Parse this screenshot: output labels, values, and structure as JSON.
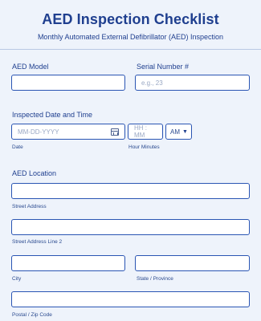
{
  "header": {
    "title": "AED Inspection Checklist",
    "subtitle": "Monthly Automated External Defibrillator (AED) Inspection"
  },
  "aed_model": {
    "label": "AED Model",
    "value": ""
  },
  "serial": {
    "label": "Serial Number #",
    "placeholder": "e.g., 23"
  },
  "inspected": {
    "label": "Inspected Date and Time",
    "date_placeholder": "MM-DD-YYYY",
    "date_sublabel": "Date",
    "time_placeholder": "HH : MM",
    "ampm_value": "AM",
    "time_sublabel": "Hour Minutes"
  },
  "location": {
    "label": "AED Location",
    "street_sublabel": "Street Address",
    "street2_sublabel": "Street Address Line 2",
    "city_sublabel": "City",
    "state_sublabel": "State / Province",
    "zip_sublabel": "Postal / Zip Code"
  },
  "icons": {
    "calendar": "calendar-icon",
    "dropdown": "chevron-down-icon"
  }
}
